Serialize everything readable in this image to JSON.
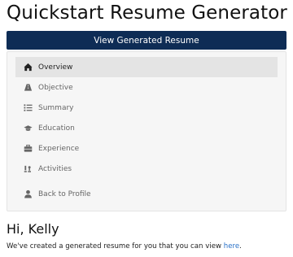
{
  "header": {
    "title": "Quickstart Resume Generator",
    "view_button_label": "View Generated Resume"
  },
  "nav": {
    "items": [
      {
        "label": "Overview",
        "icon": "home-icon",
        "active": true
      },
      {
        "label": "Objective",
        "icon": "road-icon",
        "active": false
      },
      {
        "label": "Summary",
        "icon": "list-icon",
        "active": false
      },
      {
        "label": "Education",
        "icon": "graduation-cap-icon",
        "active": false
      },
      {
        "label": "Experience",
        "icon": "briefcase-icon",
        "active": false
      },
      {
        "label": "Activities",
        "icon": "chess-icon",
        "active": false
      },
      {
        "label": "Back to Profile",
        "icon": "user-icon",
        "active": false
      }
    ]
  },
  "main": {
    "greeting": "Hi, Kelly",
    "message_prefix": "We've created a generated resume for you that you can view ",
    "message_link": "here",
    "message_suffix": "."
  },
  "colors": {
    "primary": "#0e2c55",
    "link": "#2a72c8",
    "panel_bg": "#f6f6f6",
    "active_item_bg": "#e4e4e4"
  }
}
